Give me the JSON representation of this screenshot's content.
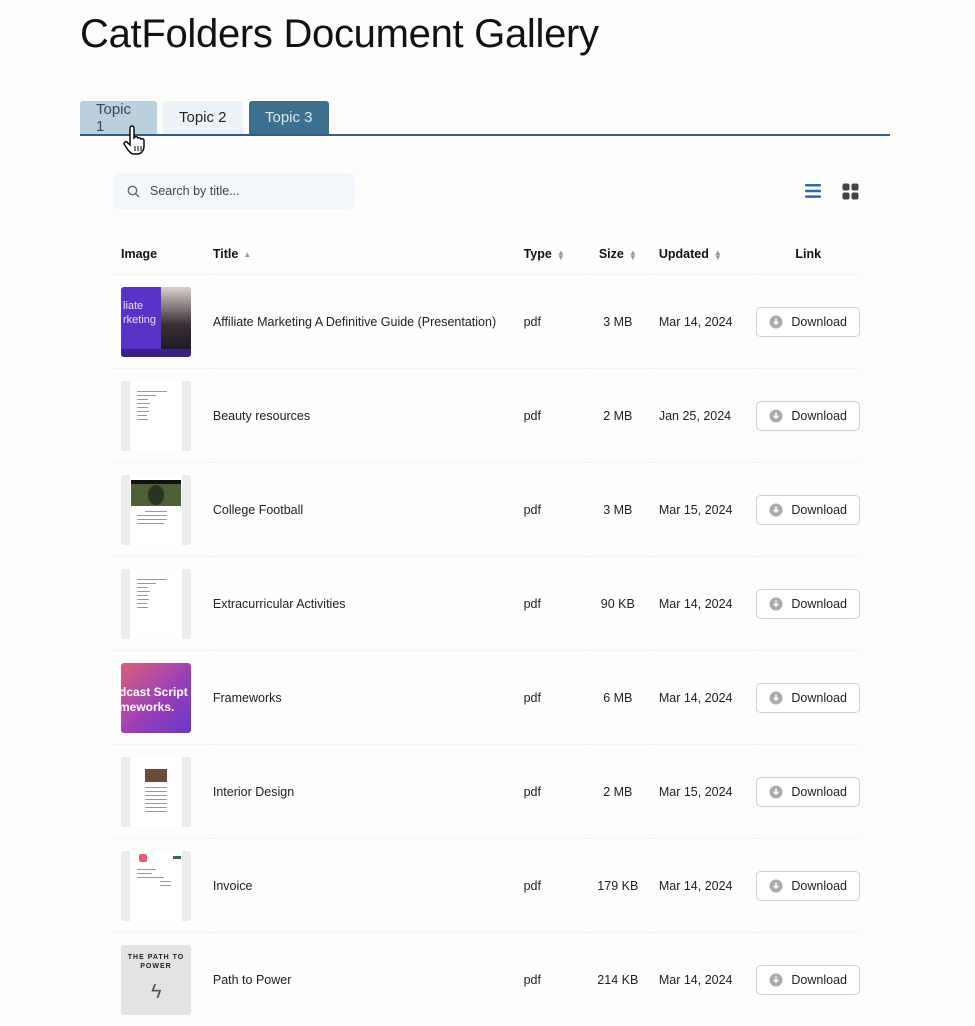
{
  "page": {
    "title": "CatFolders Document Gallery"
  },
  "tabs": [
    {
      "label": "Topic 1",
      "state": "hover"
    },
    {
      "label": "Topic 2",
      "state": "default"
    },
    {
      "label": "Topic 3",
      "state": "active"
    }
  ],
  "search": {
    "placeholder": "Search by title...",
    "value": ""
  },
  "view_toggle": {
    "list_icon": "list-icon",
    "grid_icon": "grid-icon",
    "active": "list",
    "active_color": "#2d6aa8"
  },
  "table": {
    "headers": {
      "image": "Image",
      "title": "Title",
      "type": "Type",
      "size": "Size",
      "updated": "Updated",
      "link": "Link"
    },
    "sort": {
      "column": "title",
      "direction": "asc"
    },
    "rows": [
      {
        "thumb": "purple-presentation",
        "thumb_text": "liate\nrketing",
        "title": "Affiliate Marketing A Definitive Guide (Presentation)",
        "type": "pdf",
        "size": "3 MB",
        "updated": "Mar 14, 2024",
        "link": "Download"
      },
      {
        "thumb": "document",
        "title": "Beauty resources",
        "type": "pdf",
        "size": "2 MB",
        "updated": "Jan 25, 2024",
        "link": "Download"
      },
      {
        "thumb": "football-doc",
        "title": "College Football",
        "type": "pdf",
        "size": "3 MB",
        "updated": "Mar 15, 2024",
        "link": "Download"
      },
      {
        "thumb": "document",
        "title": "Extracurricular Activities",
        "type": "pdf",
        "size": "90 KB",
        "updated": "Mar 14, 2024",
        "link": "Download"
      },
      {
        "thumb": "gradient-cover",
        "thumb_text": "dcast Script\nmeworks.",
        "title": "Frameworks",
        "type": "pdf",
        "size": "6 MB",
        "updated": "Mar 14, 2024",
        "link": "Download"
      },
      {
        "thumb": "image-doc",
        "title": "Interior Design",
        "type": "pdf",
        "size": "2 MB",
        "updated": "Mar 15, 2024",
        "link": "Download"
      },
      {
        "thumb": "invoice-doc",
        "title": "Invoice",
        "type": "pdf",
        "size": "179 KB",
        "updated": "Mar 14, 2024",
        "link": "Download"
      },
      {
        "thumb": "book-cover",
        "thumb_text": "THE PATH TO\nPOWER",
        "title": "Path to Power",
        "type": "pdf",
        "size": "214 KB",
        "updated": "Mar 14, 2024",
        "link": "Download"
      }
    ]
  }
}
